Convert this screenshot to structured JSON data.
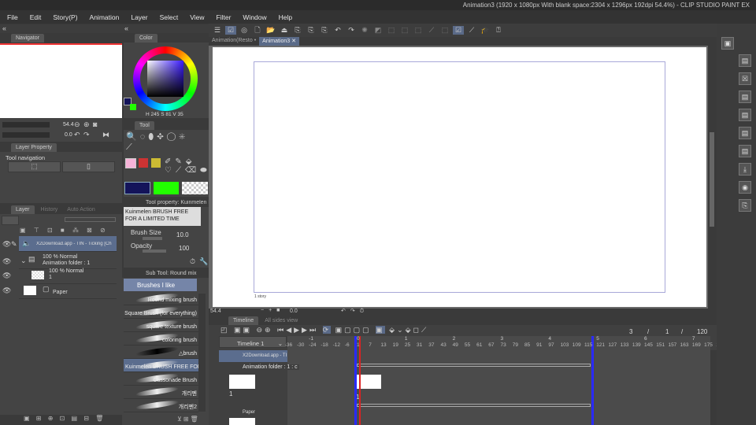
{
  "window": {
    "title": "Animation3 (1920 x 1080px With blank space:2304 x 1296px 192dpi 54.4%) - CLIP STUDIO PAINT EX"
  },
  "menu": [
    "File",
    "Edit",
    "Story(P)",
    "Animation",
    "Layer",
    "Select",
    "View",
    "Filter",
    "Window",
    "Help"
  ],
  "doc_tabs": [
    {
      "label": "Animation(Resto",
      "active": false
    },
    {
      "label": "Animation3",
      "active": true
    }
  ],
  "navigator": {
    "tab": "Navigator",
    "zoom": "54.4",
    "rotation": "0.0"
  },
  "color": {
    "tab": "Color",
    "h_label": "H",
    "h": "245",
    "s_label": "S",
    "s": "81",
    "v_label": "V",
    "v": "35",
    "main": "#14145a",
    "sub": "#22ff00"
  },
  "layer_property": {
    "tab": "Layer Property",
    "section": "Tool navigation"
  },
  "tool": {
    "tab": "Tool",
    "colors": [
      "#14145a",
      "#22ff00"
    ]
  },
  "tool_property": {
    "title": "Tool property: Kuinmelen BR",
    "preview": "Kuinmelen BRUSH FREE FOR A LIMITED TIME",
    "brush_size_label": "Brush Size",
    "brush_size": "10.0",
    "opacity_label": "Opacity",
    "opacity": "100"
  },
  "sub_tool": {
    "title": "Sub Tool: Round mix",
    "group": "Brushes I like",
    "brushes": [
      "Round mixing brush",
      "Square Brush (for everything)",
      "square texture brush",
      "coloring brush",
      "△brush",
      "Kuinmelen BRUSH FREE FOR A",
      "Cassonade Brush",
      "개리펜",
      "개리펜2"
    ],
    "selected": 5
  },
  "layers": {
    "tabs": [
      "Layer",
      "History",
      "Auto Action"
    ],
    "items": [
      {
        "name": "X2Download.app - TIN - Ticking [Chill Trap]",
        "type": "sound"
      },
      {
        "mode": "100 % Normal",
        "name": "Animation folder : 1",
        "type": "folder"
      },
      {
        "mode": "100 % Normal",
        "name": "1",
        "type": "cel"
      },
      {
        "name": "Paper",
        "type": "paper"
      }
    ]
  },
  "canvas": {
    "story_label": "1 story"
  },
  "status": {
    "zoom": "54.4",
    "rotation": "0.0"
  },
  "timeline": {
    "tab": "Timeline",
    "tab2": "All sides view",
    "name": "Timeline 1",
    "current": "3",
    "sep": "/",
    "page": "1",
    "total": "120",
    "seconds": [
      "-1",
      "0",
      "1",
      "2",
      "3",
      "4",
      "5",
      "6",
      "7"
    ],
    "frames": [
      "-36",
      "-30",
      "-24",
      "-18",
      "-12",
      "-6",
      "1",
      "7",
      "13",
      "19",
      "25",
      "31",
      "37",
      "43",
      "49",
      "55",
      "61",
      "67",
      "73",
      "79",
      "85",
      "91",
      "97",
      "103",
      "109",
      "115",
      "121",
      "127",
      "133",
      "139",
      "145",
      "151",
      "157",
      "163",
      "169",
      "175",
      "181"
    ],
    "tracks": [
      {
        "label": "X2Download.app - TI"
      },
      {
        "label": "Animation folder : 1 : c"
      },
      {
        "label": "1"
      },
      {
        "label": "Paper"
      }
    ],
    "cel_label": "1"
  }
}
